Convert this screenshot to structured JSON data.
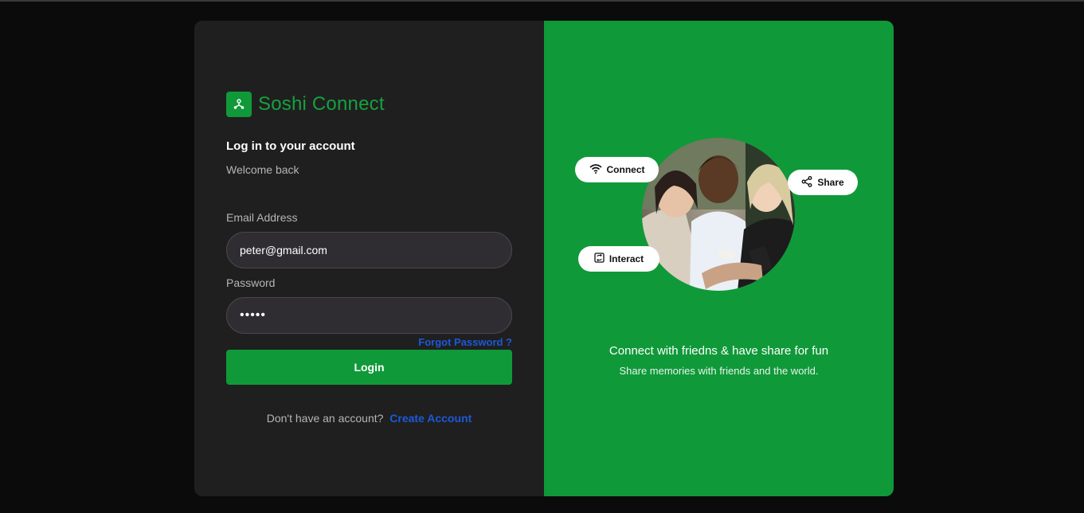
{
  "brand": {
    "name": "Soshi Connect",
    "icon": "share-nodes-icon",
    "color": "#15a23c"
  },
  "login": {
    "heading": "Log in to your account",
    "subheading": "Welcome back",
    "email_label": "Email Address",
    "email_value": "peter@gmail.com",
    "password_label": "Password",
    "password_value": "•••••",
    "forgot_label": "Forgot Password ?",
    "login_label": "Login",
    "signup_prompt": "Don't have an account?",
    "signup_link": "Create Account"
  },
  "promo": {
    "pills": [
      {
        "label": "Connect",
        "icon": "wifi-icon"
      },
      {
        "label": "Share",
        "icon": "share-icon"
      },
      {
        "label": "Interact",
        "icon": "interact-icon"
      }
    ],
    "tagline": "Connect with friedns & have share for fun",
    "subtag": "Share memories with friends and the world."
  },
  "colors": {
    "accent": "#109939",
    "link": "#1d59d6",
    "panel_dark": "#1f1f20"
  }
}
